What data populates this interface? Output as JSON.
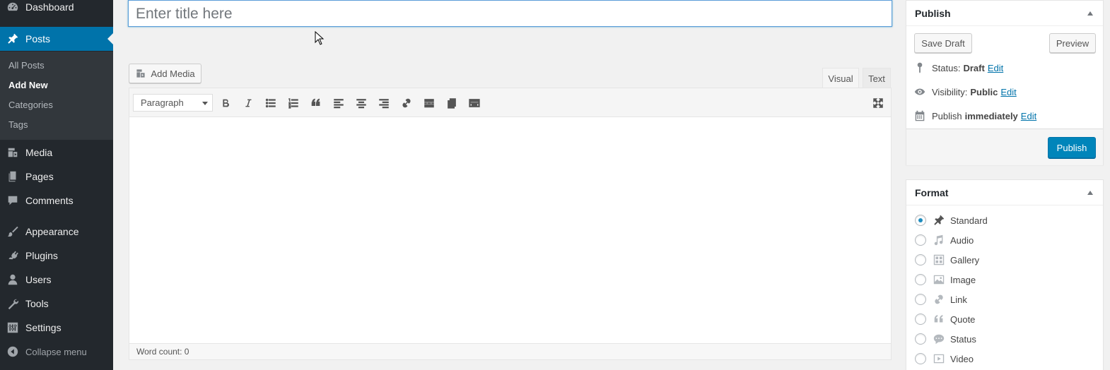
{
  "sidebar": {
    "menu": {
      "dashboard": "Dashboard",
      "posts": "Posts",
      "media": "Media",
      "pages": "Pages",
      "comments": "Comments",
      "appearance": "Appearance",
      "plugins": "Plugins",
      "users": "Users",
      "tools": "Tools",
      "settings": "Settings",
      "collapse": "Collapse menu"
    },
    "posts_submenu": {
      "all_posts": "All Posts",
      "add_new": "Add New",
      "categories": "Categories",
      "tags": "Tags"
    }
  },
  "title_field": {
    "value": "",
    "placeholder": "Enter title here"
  },
  "editor": {
    "add_media_label": "Add Media",
    "tabs": {
      "visual": "Visual",
      "text": "Text"
    },
    "active_tab": "visual",
    "format_select": "Paragraph",
    "word_count": "Word count: 0"
  },
  "publish_box": {
    "title": "Publish",
    "save_draft": "Save Draft",
    "preview": "Preview",
    "status_label": "Status:",
    "status_value": "Draft",
    "visibility_label": "Visibility:",
    "visibility_value": "Public",
    "publish_label": "Publish",
    "publish_value": "immediately",
    "edit": "Edit",
    "publish_button": "Publish"
  },
  "format_box": {
    "title": "Format",
    "selected": "Standard",
    "options": [
      "Standard",
      "Audio",
      "Gallery",
      "Image",
      "Link",
      "Quote",
      "Status",
      "Video"
    ]
  },
  "colors": {
    "sidebar_bg": "#23282d",
    "submenu_bg": "#32373c",
    "accent": "#0073aa",
    "primary_button": "#0085ba"
  }
}
